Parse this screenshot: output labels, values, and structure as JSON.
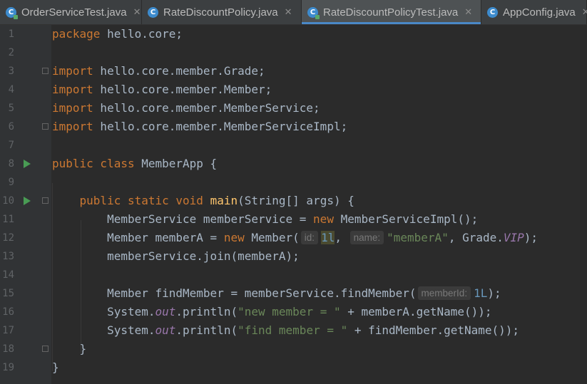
{
  "tabs": [
    {
      "label": "OrderServiceTest.java",
      "icon": "java-test-class-icon",
      "active": false,
      "width": 199
    },
    {
      "label": "RateDiscountPolicy.java",
      "icon": "java-class-icon",
      "active": false,
      "width": 224
    },
    {
      "label": "RateDiscountPolicyTest.java",
      "icon": "java-test-class-icon",
      "active": true,
      "width": 252
    },
    {
      "label": "AppConfig.java",
      "icon": "java-class-icon",
      "active": false,
      "width": 148
    }
  ],
  "editor": {
    "lines": [
      {
        "n": "1",
        "code": "<span class=\"kw\">package</span> hello.core;"
      },
      {
        "n": "2",
        "code": ""
      },
      {
        "n": "3",
        "code": "<span class=\"kw\">import</span> hello.core.member.Grade;",
        "fold": true
      },
      {
        "n": "4",
        "code": "<span class=\"kw\">import</span> hello.core.member.Member;"
      },
      {
        "n": "5",
        "code": "<span class=\"kw\">import</span> hello.core.member.MemberService;"
      },
      {
        "n": "6",
        "code": "<span class=\"kw\">import</span> hello.core.member.MemberServiceImpl;",
        "fold": true
      },
      {
        "n": "7",
        "code": ""
      },
      {
        "n": "8",
        "code": "<span class=\"kw\">public class</span> MemberApp {",
        "run": true
      },
      {
        "n": "9",
        "code": ""
      },
      {
        "n": "10",
        "code": "    <span class=\"kw\">public static void</span> <span class=\"fn\">main</span>(String[] args) {",
        "run": true,
        "fold": true
      },
      {
        "n": "11",
        "code": "        MemberService memberService = <span class=\"kw\">new</span> MemberServiceImpl();"
      },
      {
        "n": "12",
        "code": "        Member memberA = <span class=\"kw\">new</span> Member(<span class=\"hint\">id:</span><span class=\"num hl\">1l</span>, <span class=\"hint\">name:</span><span class=\"str\">\"memberA\"</span>, Grade.<span class=\"static\">VIP</span>);"
      },
      {
        "n": "13",
        "code": "        memberService.join(memberA);"
      },
      {
        "n": "14",
        "code": ""
      },
      {
        "n": "15",
        "code": "        Member findMember = memberService.findMember(<span class=\"hint\">memberId:</span><span class=\"num\">1L</span>);"
      },
      {
        "n": "16",
        "code": "        System.<span class=\"static\">out</span>.println(<span class=\"str\">\"new member = \"</span> + memberA.getName());"
      },
      {
        "n": "17",
        "code": "        System.<span class=\"static\">out</span>.println(<span class=\"str\">\"find member = \"</span> + findMember.getName());"
      },
      {
        "n": "18",
        "code": "    }",
        "fold": true
      },
      {
        "n": "19",
        "code": "}"
      }
    ]
  }
}
